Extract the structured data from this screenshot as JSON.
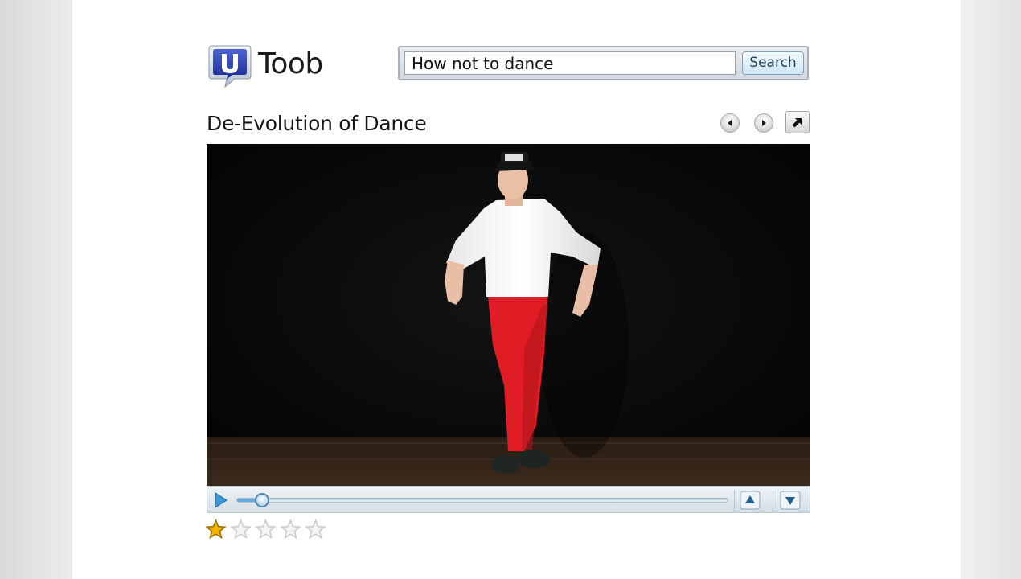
{
  "app": {
    "name": "Toob",
    "brand_color": "#2436a8"
  },
  "search": {
    "query": "How not to dance",
    "button_label": "Search"
  },
  "video": {
    "title": "De-Evolution of Dance",
    "progress": 0.05,
    "rating": {
      "value": 1,
      "max": 5,
      "filled_color": "#f4b400",
      "empty_color": "#c9c9c9"
    }
  },
  "icons": {
    "logo": "speech-bubble-u-logo",
    "prev": "arrow-left-icon",
    "next": "arrow-right-icon",
    "popout": "arrow-up-right-icon",
    "play": "play-icon",
    "volume_up": "triangle-up-icon",
    "volume_down": "triangle-down-icon",
    "star": "star-icon"
  }
}
